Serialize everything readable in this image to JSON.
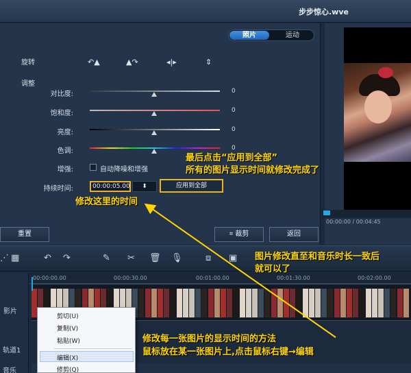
{
  "window": {
    "title": "步步惊心.wve"
  },
  "tabs": {
    "photo": "照片",
    "motion": "运动"
  },
  "rotate": {
    "label": "旋转"
  },
  "adjust": {
    "section_label": "调整",
    "contrast": {
      "label": "对比度:",
      "value": "0"
    },
    "saturation": {
      "label": "饱和度:",
      "value": "0"
    },
    "brightness": {
      "label": "亮度:",
      "value": "0"
    },
    "hue": {
      "label": "色调:",
      "value": "0"
    },
    "enhance": {
      "label": "增强:",
      "checkbox_label": "自动降噪和增强"
    }
  },
  "duration": {
    "label": "持续时间:",
    "value": "00:00:05.00",
    "apply_all": "应用到全部"
  },
  "buttons": {
    "reset": "重置",
    "crop": "裁剪",
    "back": "返回"
  },
  "preview": {
    "timecode": "00:00:00 / 00:04:45"
  },
  "ruler": {
    "t0": "00:00:00.00",
    "t1": "00:00:30.00",
    "t2": "00:01:00.00",
    "t3": "00:01:30.00",
    "t4": "00:02:00.00"
  },
  "tracks": {
    "video": "影片",
    "overlay": "轨道1",
    "music": "音乐"
  },
  "context_menu": {
    "cut": "剪切(U)",
    "copy": "复制(V)",
    "paste": "粘贴(W)",
    "edit": "编辑(X)",
    "trim": "修剪(Q)"
  },
  "annotations": {
    "apply_note_1": "最后点击“应用到全部”",
    "apply_note_2": "所有的图片显示时间就修改完成了",
    "duration_note": "修改这里的时间",
    "music_note_1": "图片修改直至和音乐时长一致后",
    "music_note_2": "就可以了",
    "edit_note_1": "修改每一张图片的显示时间的方法",
    "edit_note_2": "鼠标放在某一张图片上,点击鼠标右键→编辑"
  },
  "colors": {
    "accent": "#22a7e8",
    "highlight": "#f0b21f",
    "annotation": "#ffd400"
  }
}
